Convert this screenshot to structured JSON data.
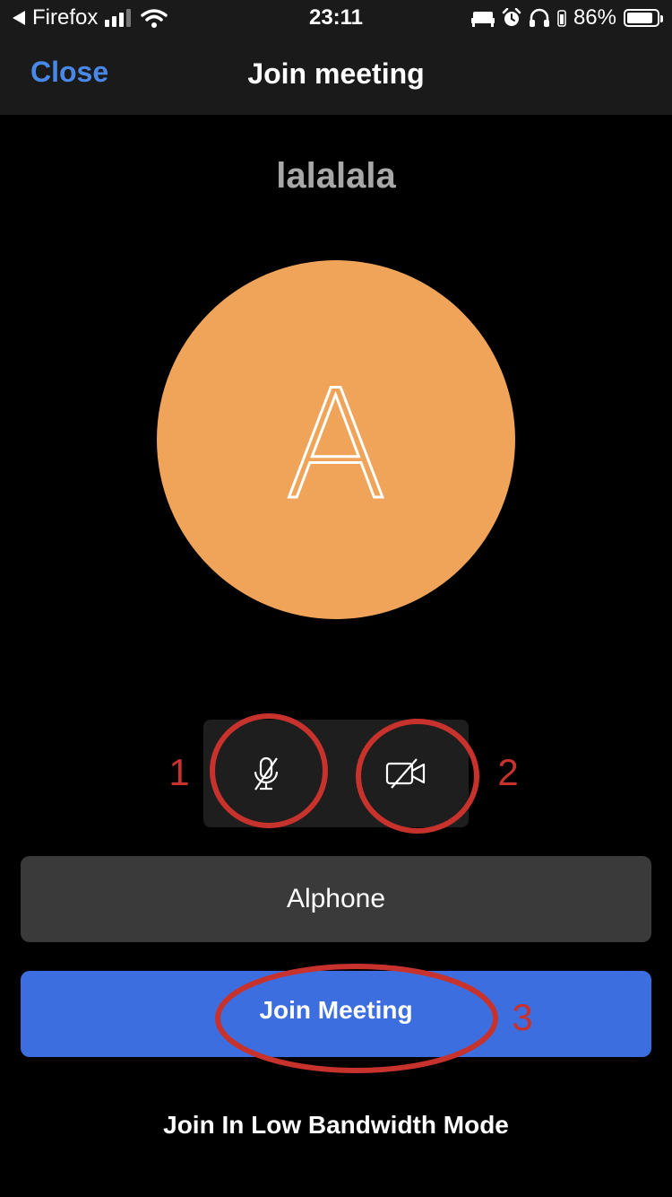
{
  "status_bar": {
    "back_app": "Firefox",
    "time": "23:11",
    "battery_percent": "86%",
    "battery_level": 0.86,
    "icons": [
      "back-arrow-icon",
      "signal-icon",
      "wifi-icon",
      "bed-icon",
      "alarm-icon",
      "headphones-icon",
      "battery-icon"
    ]
  },
  "nav": {
    "close_label": "Close",
    "title": "Join meeting"
  },
  "meeting": {
    "name": "lalalala",
    "avatar_initial": "A",
    "avatar_color": "#f0a45a"
  },
  "controls": {
    "mic_icon": "microphone-muted-icon",
    "video_icon": "video-off-icon"
  },
  "display_name": {
    "value": "Alphone"
  },
  "join_button": {
    "label": "Join Meeting",
    "color": "#3d6ee0"
  },
  "low_bandwidth": {
    "label": "Join In Low Bandwidth Mode"
  },
  "annotations": {
    "color": "#c8322d",
    "labels": [
      "1",
      "2",
      "3"
    ]
  }
}
